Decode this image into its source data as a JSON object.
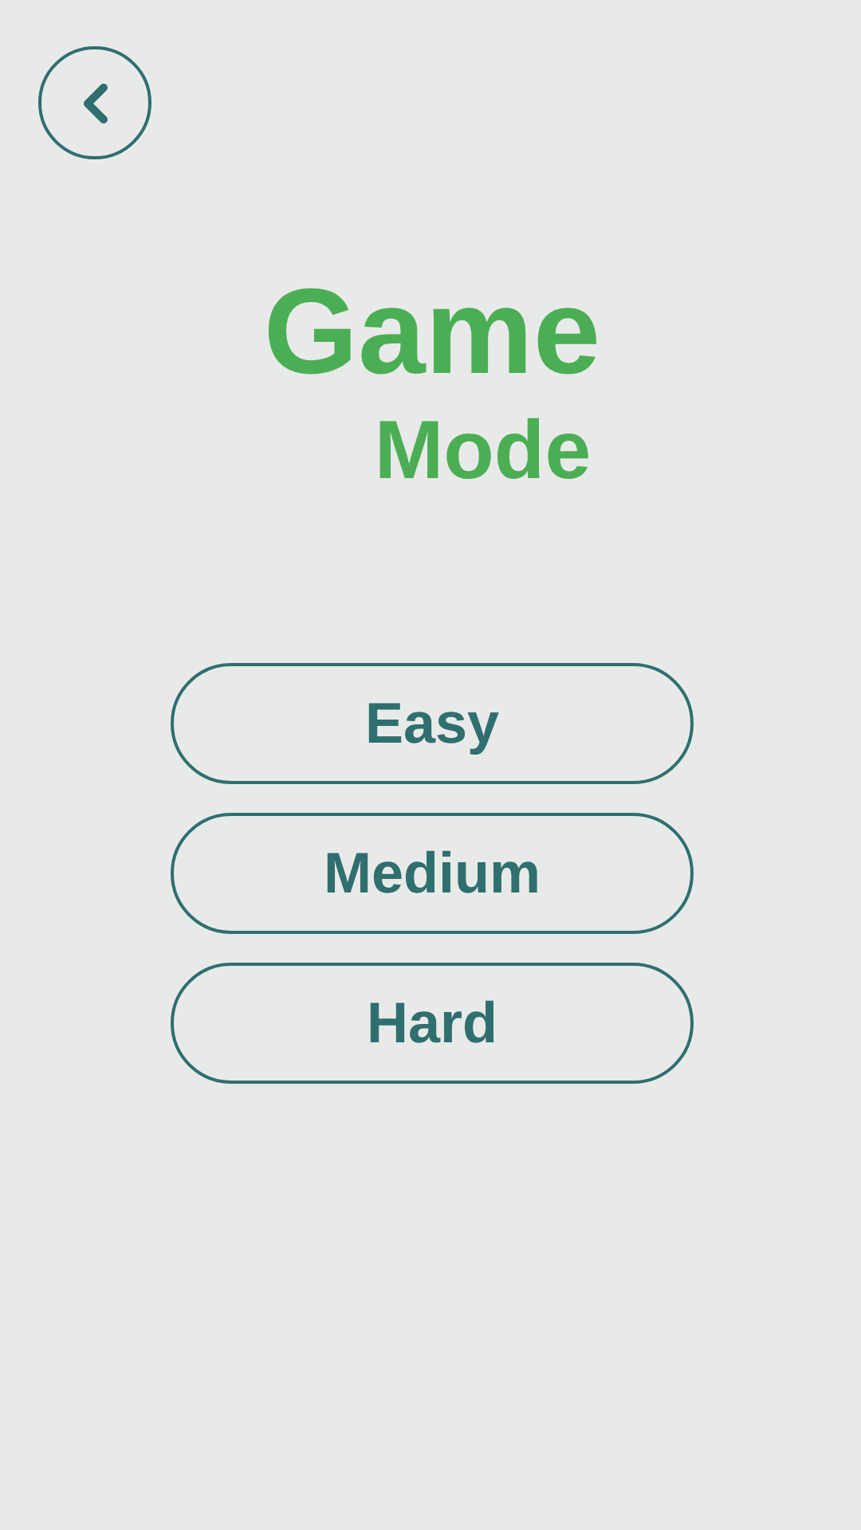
{
  "title": {
    "line_1": "Game",
    "line_2": "Mode"
  },
  "modes": [
    {
      "label": "Easy"
    },
    {
      "label": "Medium"
    },
    {
      "label": "Hard"
    }
  ]
}
